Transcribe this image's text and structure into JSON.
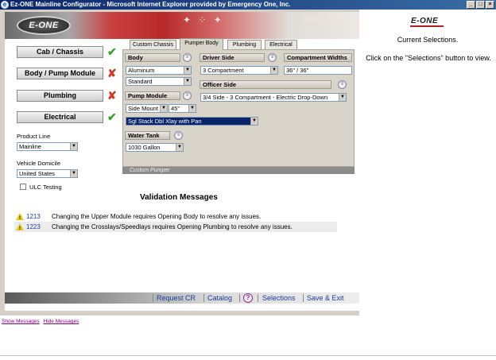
{
  "window": {
    "title": "Ez-ONE Mainline Configurator - Microsoft Internet Explorer provided by Emergency One, Inc.",
    "buttons": [
      "_",
      "□",
      "×"
    ]
  },
  "banner": {
    "logo_text": "E-ONE",
    "version": "version 1.2.0.05"
  },
  "nav": {
    "items": [
      {
        "label": "Cab / Chassis",
        "status": "complete",
        "mark": "✔"
      },
      {
        "label": "Body / Pump Module",
        "status": "incomplete",
        "mark": "✘"
      },
      {
        "label": "Plumbing",
        "status": "incomplete",
        "mark": "✘"
      },
      {
        "label": "Electrical",
        "status": "complete",
        "mark": "✔"
      }
    ]
  },
  "left_form": {
    "product_line_label": "Product Line",
    "product_line_value": "Mainline",
    "vehicle_domicile_label": "Vehicle Domicile",
    "vehicle_domicile_value": "United States",
    "ulc_label": "ULC Testing",
    "ulc_checked": false
  },
  "tabs": [
    {
      "label": "Custom Chassis",
      "active": false
    },
    {
      "label": "Pumper Body",
      "active": true
    },
    {
      "label": "Plumbing",
      "active": false
    },
    {
      "label": "Electrical",
      "active": false
    }
  ],
  "pumper_body": {
    "body_header": "Body",
    "body_material": "Aluminum",
    "body_style": "Standard",
    "driver_side_header": "Driver Side",
    "driver_side_value": "3 Compartment",
    "compartment_widths_header": "Compartment Widths",
    "compartment_widths_value": "36\" / 36\"",
    "officer_side_header": "Officer Side",
    "officer_side_value": "3/4 Side - 3 Compartment - Electric Drop-Down",
    "pump_module_header": "Pump Module",
    "pump_mount": "Side Mount",
    "pump_size": "45\"",
    "crosslay": "Sgl Stack Dbl Xlay with Pan",
    "water_tank_header": "Water Tank",
    "water_tank_value": "1030 Gallon",
    "panel_footer": "Custom Pumper"
  },
  "validation": {
    "title": "Validation Messages",
    "messages": [
      {
        "code": "1213",
        "text": "Changing the Upper Module requires Opening Body to resolve any issues."
      },
      {
        "code": "1223",
        "text": "Changing the Crosslays/Speedlays requires Opening Plumbing to resolve any issues."
      }
    ]
  },
  "toolbar": {
    "request_cr": "Request CR",
    "catalog": "Catalog",
    "help": "?",
    "selections": "Selections",
    "save_exit": "Save & Exit"
  },
  "right_panel": {
    "logo_text": "E-ONE",
    "title": "Current Selections.",
    "instruction": "Click on the \"Selections\" button to view."
  },
  "bottom_links": {
    "show": "Show Messages",
    "hide": "Hide Messages"
  },
  "colors": {
    "check_ok": "#3aa22a",
    "mark_bad": "#d23a2a",
    "link": "#1a3a98",
    "titlebar": "#0a246a"
  }
}
